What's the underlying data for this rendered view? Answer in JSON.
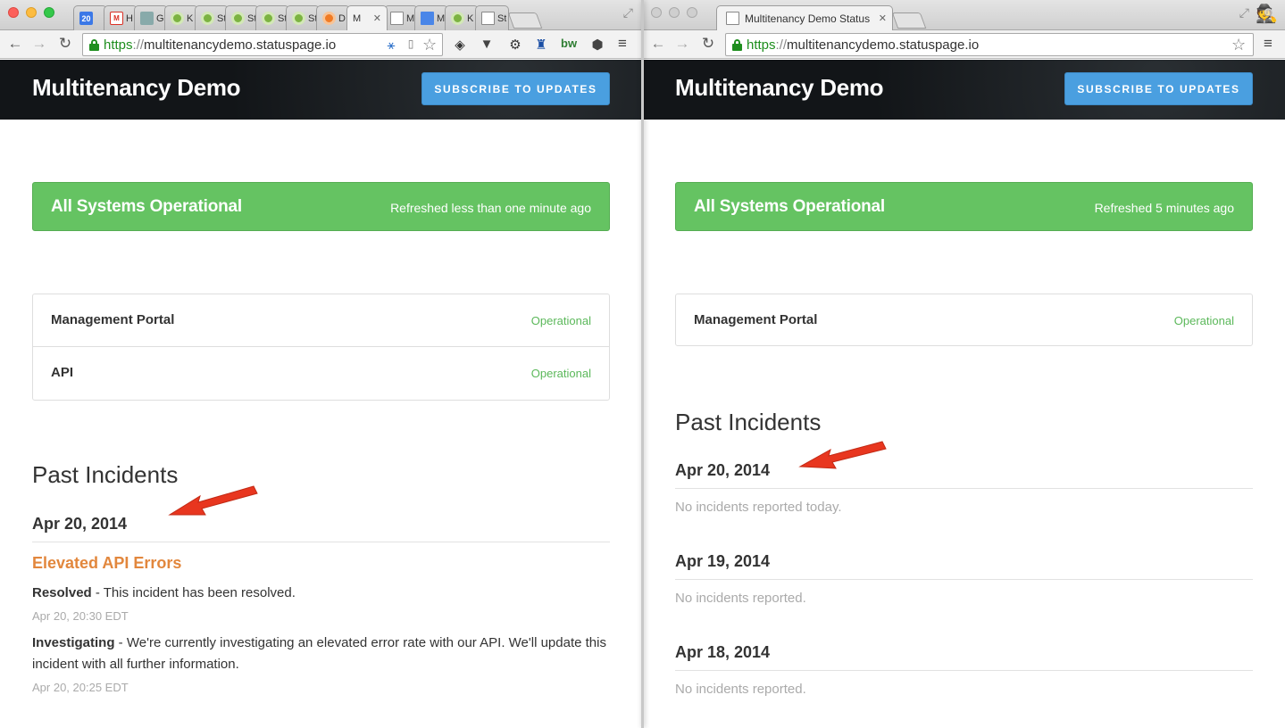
{
  "colors": {
    "operational_green": "#65c362",
    "status_text_green": "#5bb85a",
    "subscribe_blue": "#4a9fe0",
    "incident_orange": "#e2873d",
    "masthead_dark": "#121518",
    "arrow_red": "#e8361f"
  },
  "left_window": {
    "tabs": [
      {
        "icon": "calendar-icon",
        "label": "20"
      },
      {
        "icon": "gmail-icon",
        "label": "H"
      },
      {
        "icon": "gears-icon",
        "label": "G"
      },
      {
        "icon": "statuspage-icon",
        "label": "K"
      },
      {
        "icon": "statuspage-icon",
        "label": "St"
      },
      {
        "icon": "statuspage-icon",
        "label": "St"
      },
      {
        "icon": "statuspage-icon",
        "label": "St"
      },
      {
        "icon": "statuspage-icon",
        "label": "St"
      },
      {
        "icon": "statuspage-icon",
        "label": "D"
      },
      {
        "icon": "none",
        "label": "M",
        "active": true,
        "close": "✕"
      },
      {
        "icon": "document-icon",
        "label": "M"
      },
      {
        "icon": "google-docs-icon",
        "label": "M"
      },
      {
        "icon": "statuspage-icon",
        "label": "K"
      },
      {
        "icon": "document-icon",
        "label": "St"
      }
    ],
    "url": {
      "scheme": "https",
      "sep": "://",
      "host": "multitenancydemo.statuspage.io"
    },
    "page": {
      "site_title": "Multitenancy Demo",
      "subscribe_label": "SUBSCRIBE TO UPDATES",
      "status_title": "All Systems Operational",
      "status_refreshed": "Refreshed less than one minute ago",
      "components": [
        {
          "name": "Management Portal",
          "status": "Operational"
        },
        {
          "name": "API",
          "status": "Operational"
        }
      ],
      "past_incidents_heading": "Past Incidents",
      "day": "Apr 20, 2014",
      "incident": {
        "title": "Elevated API Errors",
        "updates": [
          {
            "status": "Resolved",
            "sep": " - ",
            "text": "This incident has been resolved.",
            "time": "Apr 20, 20:30 EDT"
          },
          {
            "status": "Investigating",
            "sep": " - ",
            "text": "We're currently investigating an elevated error rate with our API. We'll update this incident with all further information.",
            "time": "Apr 20, 20:25 EDT"
          }
        ]
      }
    }
  },
  "right_window": {
    "tab": {
      "label": "Multitenancy Demo Status",
      "close": "✕"
    },
    "url": {
      "scheme": "https",
      "sep": "://",
      "host": "multitenancydemo.statuspage.io"
    },
    "page": {
      "site_title": "Multitenancy Demo",
      "subscribe_label": "SUBSCRIBE TO UPDATES",
      "status_title": "All Systems Operational",
      "status_refreshed": "Refreshed 5 minutes ago",
      "components": [
        {
          "name": "Management Portal",
          "status": "Operational"
        }
      ],
      "past_incidents_heading": "Past Incidents",
      "days": [
        {
          "date": "Apr 20, 2014",
          "message": "No incidents reported today."
        },
        {
          "date": "Apr 19, 2014",
          "message": "No incidents reported."
        },
        {
          "date": "Apr 18, 2014",
          "message": "No incidents reported."
        }
      ]
    }
  }
}
